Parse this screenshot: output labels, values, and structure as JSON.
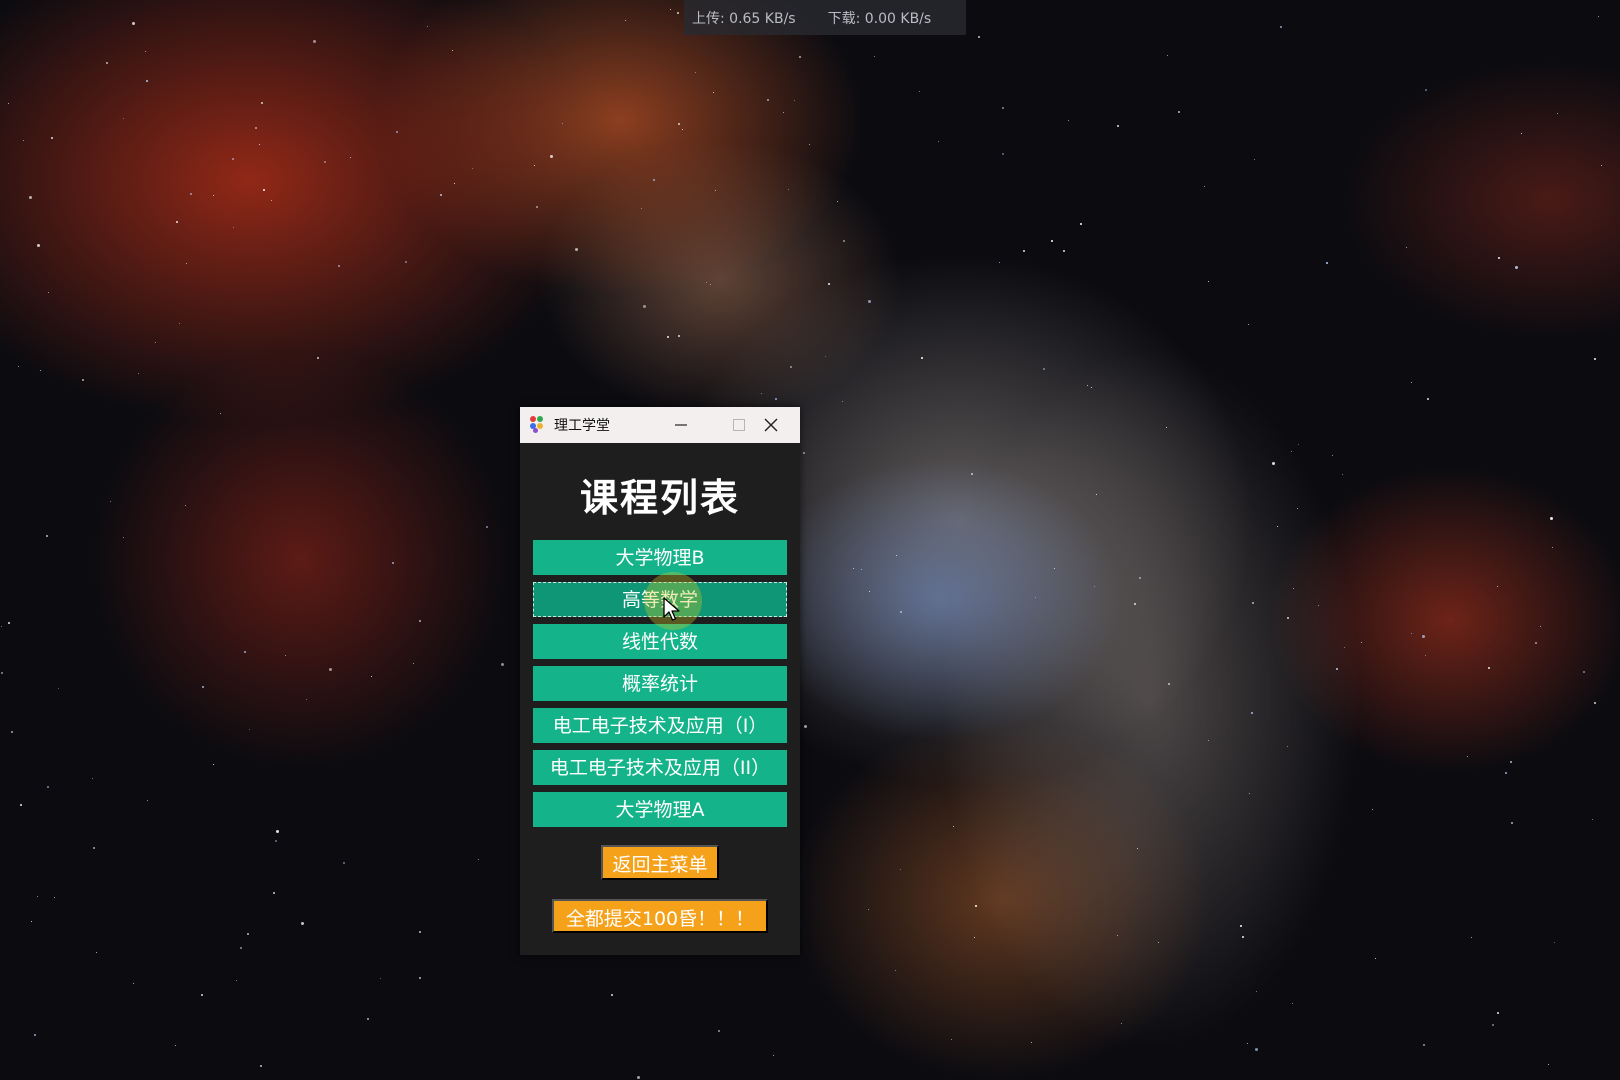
{
  "network_widget": {
    "upload": "上传: 0.65 KB/s",
    "download": "下载: 0.00 KB/s"
  },
  "window": {
    "title": "理工学堂",
    "minimize_icon": "minimize-icon",
    "maximize_icon": "maximize-icon",
    "close_icon": "close-icon",
    "heading": "课程列表",
    "courses": [
      {
        "label": "大学物理B"
      },
      {
        "label": "高等数学"
      },
      {
        "label": "线性代数"
      },
      {
        "label": "概率统计"
      },
      {
        "label": "电工电子技术及应用（I）"
      },
      {
        "label": "电工电子技术及应用（II）"
      },
      {
        "label": "大学物理A"
      }
    ],
    "back_button": "返回主菜单",
    "submit_all_button": "全都提交100昏！！！"
  },
  "colors": {
    "course_button": "#14b38a",
    "action_button": "#f5a11a",
    "window_background": "#1e1e1e"
  }
}
